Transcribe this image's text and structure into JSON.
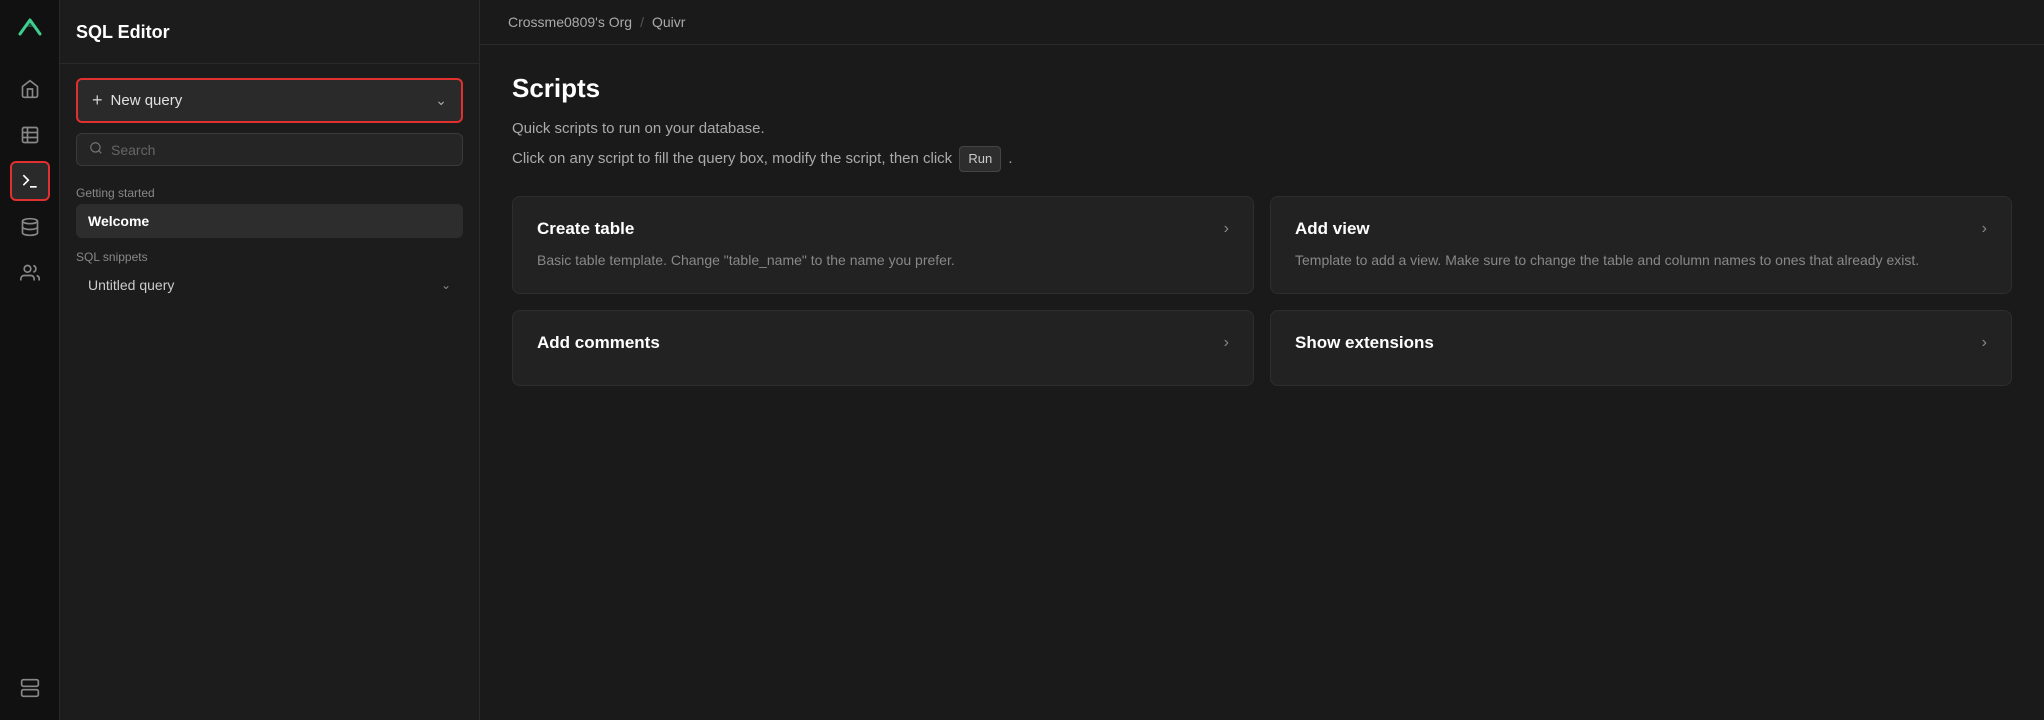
{
  "app": {
    "name": "SQL Editor"
  },
  "breadcrumb": {
    "org": "Crossme0809's Org",
    "separator": "/",
    "project": "Quivr"
  },
  "sidebar": {
    "icons": [
      {
        "name": "home-icon",
        "symbol": "⌂",
        "active": false
      },
      {
        "name": "table-icon",
        "symbol": "▦",
        "active": false
      },
      {
        "name": "terminal-icon",
        "symbol": "⊡",
        "active": true
      },
      {
        "name": "database-icon",
        "symbol": "⊛",
        "active": false
      },
      {
        "name": "users-icon",
        "symbol": "⚇",
        "active": false
      },
      {
        "name": "storage-icon",
        "symbol": "▬",
        "active": false
      }
    ]
  },
  "left_panel": {
    "new_query_label": "New query",
    "search_placeholder": "Search",
    "sections": [
      {
        "label": "Getting started",
        "items": [
          {
            "name": "Welcome",
            "active": true
          }
        ]
      },
      {
        "label": "SQL snippets",
        "items": [
          {
            "name": "Untitled query",
            "has_chevron": true,
            "active": false
          }
        ]
      }
    ]
  },
  "main": {
    "scripts": {
      "title": "Scripts",
      "desc_line1": "Quick scripts to run on your database.",
      "desc_line2_prefix": "Click on any script to fill the query box, modify the script, then click",
      "run_badge": "Run",
      "desc_line2_suffix": ".",
      "cards": [
        {
          "title": "Create table",
          "desc": "Basic table template. Change \"table_name\" to the name you prefer."
        },
        {
          "title": "Add view",
          "desc": "Template to add a view. Make sure to change the table and column names to ones that already exist."
        },
        {
          "title": "Add comments",
          "desc": ""
        },
        {
          "title": "Show extensions",
          "desc": ""
        }
      ]
    }
  },
  "colors": {
    "accent": "#3ecf8e",
    "highlight_border": "#e03030"
  }
}
